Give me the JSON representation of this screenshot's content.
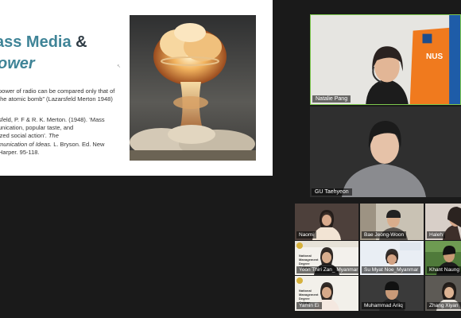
{
  "slide": {
    "title_line1": "ass Media",
    "title_amp": "&",
    "title_line2": "ower",
    "quote": "power of radio can be compared only that of the atomic bomb” (Lazarsfeld Merton 1948)",
    "reference_line1": "sfeld, P. F & R. K. Merton. (1948). ‘Mass",
    "reference_line2": "unication, popular taste, and",
    "reference_line3": "ized social action’.",
    "reference_italic": "The",
    "reference_line4": "munication of Ideas.",
    "reference_line5": " L. Bryson. Ed. New",
    "reference_line6": "Harper. 95-118.",
    "photo_icon": "atomic-bomb-mushroom-cloud-photo"
  },
  "participants": {
    "natalie": "Natalie Pang",
    "gu": "GU Taehyeon",
    "naomi": "Naomi",
    "bae": "Bae Jeong-Woon",
    "haleh": "Haleh",
    "yoon": "Yoon Thiri Zan_ Myanmar",
    "su": "Su Myat Noe_Myanmar",
    "khant": "Khant Naung",
    "yamin": "Yamin Ei",
    "muhammad": "Muhammad Ariiq",
    "zhang": "Zhang Xiyan"
  },
  "background_text": {
    "nus_logo": "NUS",
    "college_label": "National Management Degree College"
  },
  "colors": {
    "title_teal": "#3f8497",
    "active_speaker_border": "#7ec84e"
  }
}
